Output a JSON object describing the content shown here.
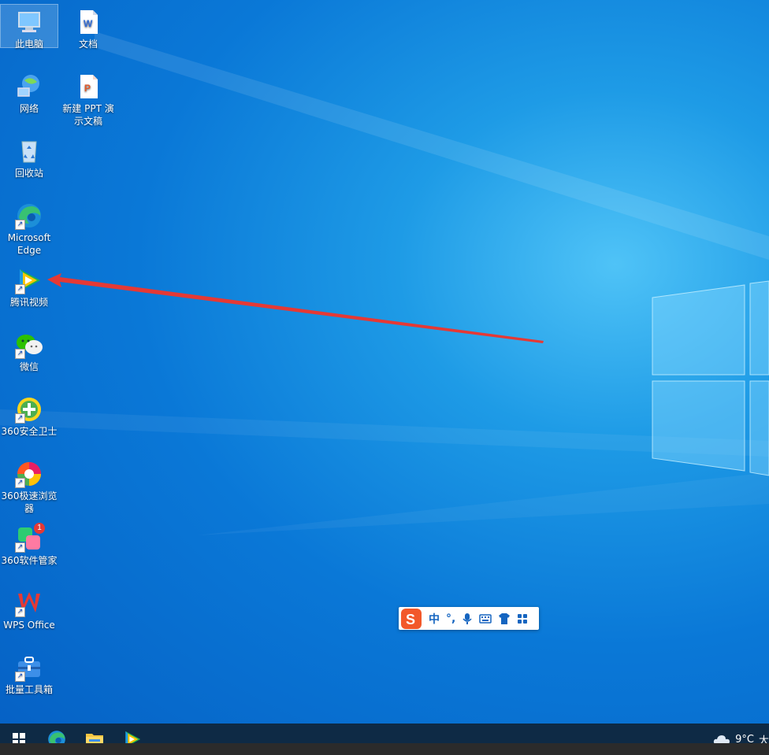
{
  "desktop": {
    "icons": [
      {
        "label": "此电脑",
        "icon": "computer-icon"
      },
      {
        "label": "文档",
        "icon": "word-document-icon"
      },
      {
        "label": "网络",
        "icon": "network-icon"
      },
      {
        "label": "新建 PPT 演示文稿",
        "icon": "ppt-document-icon"
      },
      {
        "label": "回收站",
        "icon": "recycle-bin-icon"
      },
      {
        "label": "Microsoft Edge",
        "icon": "edge-icon"
      },
      {
        "label": "腾讯视频",
        "icon": "tencent-video-icon"
      },
      {
        "label": "微信",
        "icon": "wechat-icon"
      },
      {
        "label": "360安全卫士",
        "icon": "360-security-icon"
      },
      {
        "label": "360极速浏览器",
        "icon": "360-browser-icon"
      },
      {
        "label": "360软件管家",
        "icon": "360-software-manager-icon",
        "badge": "1"
      },
      {
        "label": "WPS Office",
        "icon": "wps-office-icon"
      },
      {
        "label": "批量工具箱",
        "icon": "toolbox-icon"
      }
    ]
  },
  "ime_toolbar": {
    "mode": "中",
    "punct": "°,",
    "icons": [
      "sogou-logo-icon",
      "microphone-icon",
      "keyboard-icon",
      "skin-shirt-icon",
      "toolbox-grid-icon"
    ]
  },
  "taskbar": {
    "pinned": [
      "start-icon",
      "edge-icon",
      "file-explorer-icon",
      "tencent-video-icon"
    ],
    "weather_temp": "9°C",
    "weather_text": "大"
  },
  "colors": {
    "arrow": "#e53935",
    "taskbar": "#0e2a45",
    "wallpaper": "#0a78d7"
  }
}
